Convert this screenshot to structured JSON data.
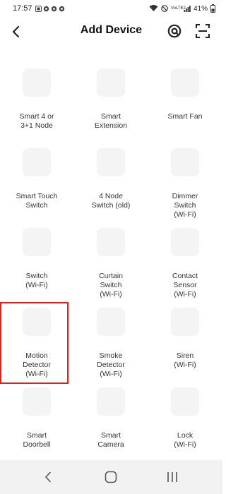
{
  "status_bar": {
    "time": "17:57",
    "battery": "41%",
    "network": "VoLTE2",
    "notif_icons": [
      "sim-icon",
      "gear-icon",
      "gear-icon",
      "gear-icon"
    ]
  },
  "header": {
    "title": "Add Device"
  },
  "devices": [
    {
      "label": "Smart 4 or\n3+1 Node"
    },
    {
      "label": "Smart\nExtension"
    },
    {
      "label": "Smart Fan"
    },
    {
      "label": "Smart Touch\nSwitch"
    },
    {
      "label": "4 Node\nSwitch (old)"
    },
    {
      "label": "Dimmer\nSwitch\n(Wi-Fi)"
    },
    {
      "label": "Switch\n(Wi-Fi)"
    },
    {
      "label": "Curtain\nSwitch\n(Wi-Fi)"
    },
    {
      "label": "Contact\nSensor\n(Wi-Fi)"
    },
    {
      "label": "Motion\nDetector\n(Wi-Fi)",
      "selected": true
    },
    {
      "label": "Smoke\nDetector\n(Wi-Fi)"
    },
    {
      "label": "Siren\n(Wi-Fi)"
    },
    {
      "label": "Smart\nDoorbell"
    },
    {
      "label": "Smart\nCamera"
    },
    {
      "label": "Lock\n(Wi-Fi)"
    }
  ],
  "colors": {
    "tile_icon_bg": "#f4f4f4",
    "highlight": "#dd2222",
    "nav_bg": "#f2f2f2"
  }
}
